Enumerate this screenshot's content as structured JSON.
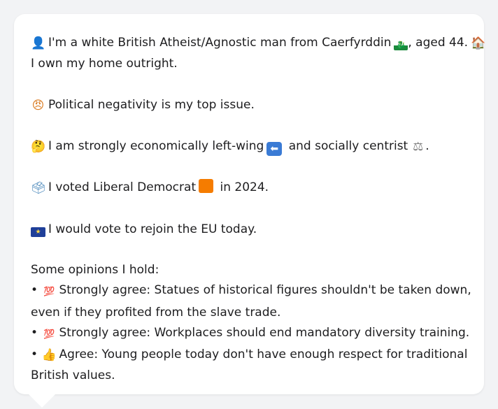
{
  "profile": {
    "intro": {
      "prefix": "I'm a white British Atheist/Agnostic man from Caerfyrddin",
      "suffix": ", aged 44.",
      "home": "I own my home outright."
    },
    "top_issue": "Political negativity is my top issue.",
    "economics": {
      "prefix": "I am strongly economically left-wing",
      "middle": "and socially centrist",
      "suffix": "."
    },
    "vote": {
      "prefix": "I voted Liberal Democrat",
      "suffix": "in 2024."
    },
    "eu": "I would vote to rejoin the EU today.",
    "opinions_header": "Some opinions I hold:",
    "opinions": [
      {
        "bullet": "•",
        "line1": "Strongly agree: Statues of historical figures shouldn't be taken down,",
        "line2": "even if they profited from the slave trade."
      },
      {
        "bullet": "•",
        "line1": "Strongly agree: Workplaces should end mandatory diversity training."
      },
      {
        "bullet": "•",
        "line1": "Agree: Young people today don't have enough respect for traditional",
        "line2": "British values."
      }
    ]
  },
  "icons": {
    "person": "person-icon",
    "wales_flag": "wales-flag-icon",
    "house": "house-icon",
    "angry_face": "angry-face-icon",
    "thinking_face": "thinking-face-icon",
    "left_arrow": "left-arrow-icon",
    "scales": "balance-scale-icon",
    "ballot_box": "ballot-box-icon",
    "orange_square": "orange-square-icon",
    "eu_flag": "eu-flag-icon",
    "hundred": "hundred-points-icon",
    "thumbs_up": "thumbs-up-icon"
  },
  "colors": {
    "background": "#f2f3f5",
    "bubble": "#ffffff",
    "text": "#1d1d1f",
    "lib_dem_orange": "#f57c00"
  }
}
